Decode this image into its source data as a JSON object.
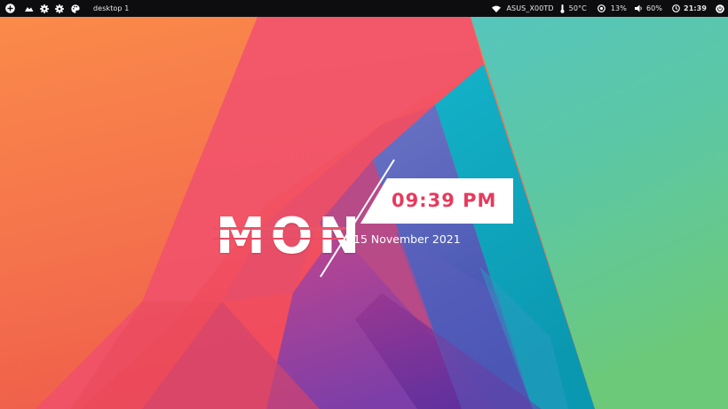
{
  "topbar": {
    "left": {
      "icons": [
        "plus-circle-icon",
        "cloud-icon",
        "gear-icon",
        "gear-icon",
        "palette-icon"
      ],
      "workspace_label": "desktop 1"
    },
    "right": {
      "wifi_icon": "wifi-icon",
      "network_name": "ASUS_X00TD",
      "temp_icon": "thermometer-icon",
      "temperature": "50°C",
      "cpu_icon": "cpu-icon",
      "cpu_usage": "13%",
      "volume_icon": "speaker-icon",
      "volume": "60%",
      "clock_icon": "clock-icon",
      "clock": "21:39",
      "power_icon": "power-icon"
    }
  },
  "clock_widget": {
    "day": "MON",
    "time": "09:39 PM",
    "date": "15 November 2021"
  },
  "colors": {
    "bar_bg": "#0d0d0f",
    "time_text": "#e83a5e",
    "wallpaper_orange": "#f88a48",
    "wallpaper_teal": "#4fc7b9",
    "wallpaper_pink": "#f0566a"
  }
}
